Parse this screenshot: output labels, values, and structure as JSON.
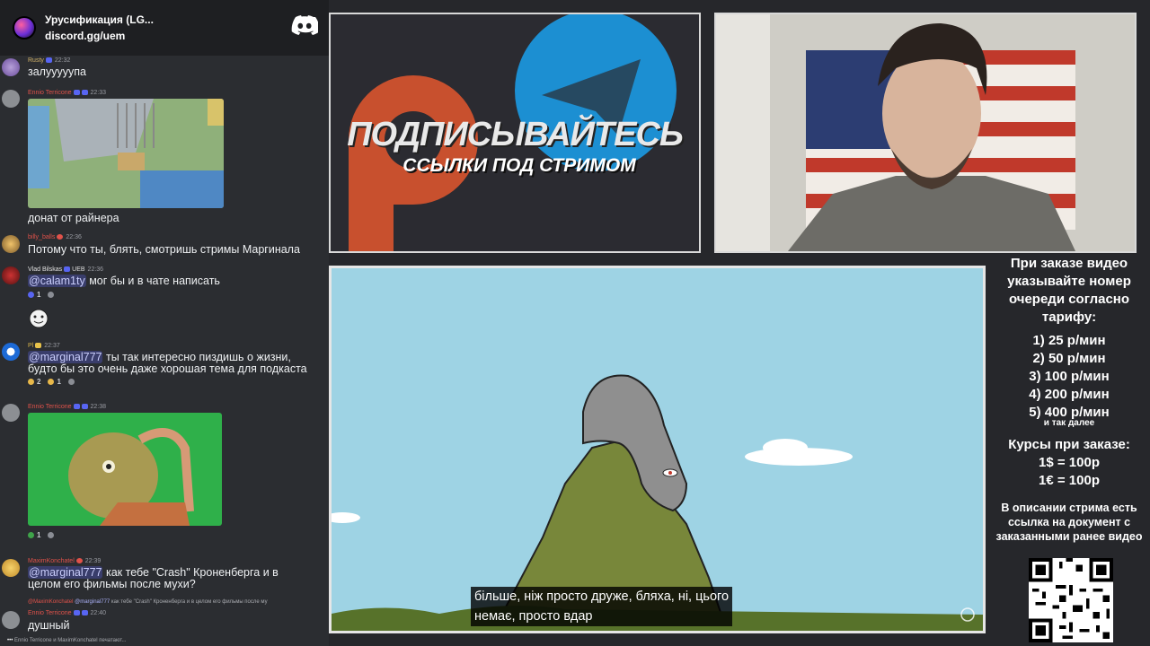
{
  "chat": {
    "server_name": "Урусификация (LG...",
    "server_invite": "discord.gg/uem",
    "messages": [
      {
        "user": "Rusty",
        "time": "22:32",
        "text": "залууууупа"
      },
      {
        "user": "Ennio Terricone",
        "time": "22:33"
      },
      {
        "text": "донат от райнера"
      },
      {
        "user": "billy_balls",
        "time": "22:36",
        "text": "Потому что ты, блять, смотришь стримы Маргинала"
      },
      {
        "user": "Vlad Bilskas",
        "badge": "UEB",
        "time": "22:36",
        "mention": "@calam1ty",
        "text": "мог бы и в чате написать",
        "reaction": "1"
      },
      {
        "user": "Pl",
        "time": "22:37",
        "mention": "@marginal777",
        "text": "ты так интересно пиздишь о жизни,",
        "text2": "будто бы это очень даже хорошая тема для подкаста",
        "reaction1": "2",
        "reaction2": "1"
      },
      {
        "user": "Ennio Terricone",
        "time": "22:38",
        "reaction": "1"
      },
      {
        "user": "MaximKonchatel",
        "time": "22:39",
        "mention": "@marginal777",
        "text": "как тебе \"Crash\" Кроненберга и в",
        "text2": "целом его фильмы после мухи?"
      },
      {
        "reply_user": "@MaximKonchatel",
        "reply_mention": "@marginal777",
        "reply_text": "как тебе \"Crash\" Кроненберга и в целом его фильмы после му"
      },
      {
        "user": "Ennio Terricone",
        "time": "22:40",
        "text": "душный"
      }
    ],
    "typing": "Ennio Terricone и MaximKonchatel печатают..."
  },
  "promo": {
    "title": "ПОДПИСЫВАЙТЕСЬ",
    "subtitle": "ССЫЛКИ ПОД СТРИМОМ"
  },
  "video": {
    "subtitle_line1": "більше, ніж просто друже, бляха, ні, цього",
    "subtitle_line2": "немає, просто вдар"
  },
  "info": {
    "heading": "При заказе видео указывайте номер очереди согласно тарифу:",
    "tiers": [
      "1) 25 р/мин",
      "2) 50 р/мин",
      "3) 100 р/мин",
      "4) 200 р/мин",
      "5) 400 р/мин"
    ],
    "etc": "и так далее",
    "courses": "Курсы при заказе:",
    "rate_usd": "1$ = 100р",
    "rate_eur": "1€ = 100р",
    "note": "В описании стрима есть ссылка на документ с заказанными ранее видео"
  },
  "colors": {
    "chat_bg": "#2b2d31",
    "username_red": "#e0524a",
    "mention_blue": "#5865f2",
    "video_sky": "#9ed3e4",
    "telegram_blue": "#1c8fd2",
    "patreon_orange": "#c8502e"
  }
}
